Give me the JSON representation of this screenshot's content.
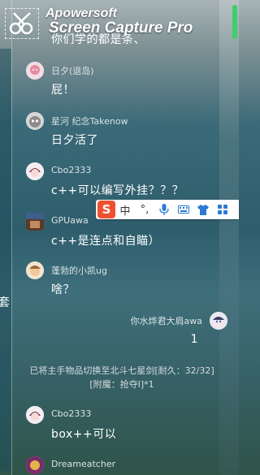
{
  "watermark": {
    "line1": "Apowersoft",
    "line2": "Screen Capture Pro"
  },
  "top_partial": {
    "name": "…[partially hidden]",
    "text": "你们学的都是条、"
  },
  "messages": [
    {
      "name": "日夕(退岛)",
      "text": "屁！"
    },
    {
      "name": "星河 纪念Takenow",
      "text": "日夕活了"
    },
    {
      "name": "Cbo2333",
      "text": "c++可以编写外挂？？？"
    },
    {
      "name": "GPUawa",
      "text": "c++是连点和自瞄）"
    },
    {
      "name": "蓬勃的小凯ug",
      "text": "啥？"
    }
  ],
  "self_message": {
    "name": "你水烨君大肩awa",
    "text": "1"
  },
  "system_notice": {
    "line1": "已将主手物品切换至北斗七星剑[耐久：32/32]",
    "line2": "[附魔：抢夺I]*1"
  },
  "message_last": {
    "name": "Cbo2333",
    "text": "box++可以"
  },
  "bottom_partial": {
    "name": "Dreameatcher"
  },
  "edge_char": "套",
  "ime": {
    "logo": "S",
    "items": [
      "中",
      "°,",
      "mic",
      "keyboard",
      "shirt",
      "grid"
    ]
  },
  "colors": {
    "ime_logo": "#f0502f",
    "ime_icon": "#2b7ad6",
    "scroll": "#3ccf6a"
  }
}
